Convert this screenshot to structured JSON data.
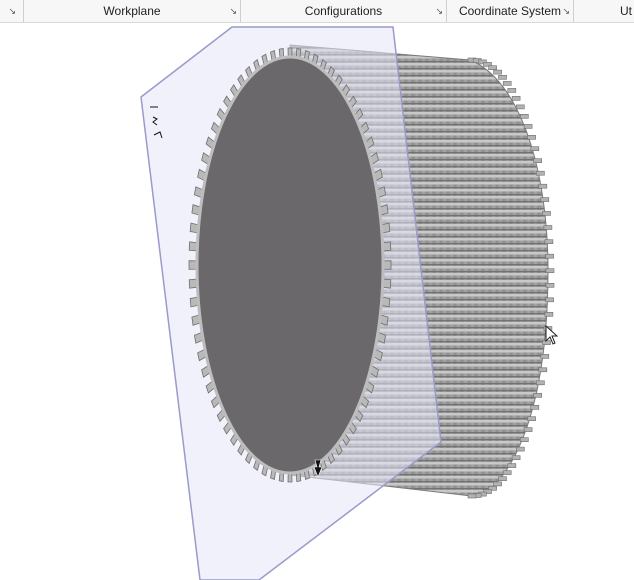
{
  "ribbon": {
    "groups": [
      {
        "label": "",
        "launcher": "↘"
      },
      {
        "label": "Workplane",
        "launcher": "↘"
      },
      {
        "label": "Configurations",
        "launcher": "↘"
      },
      {
        "label": "Coordinate System",
        "launcher": "↘"
      },
      {
        "label": "Ut",
        "launcher": ""
      }
    ]
  },
  "model": {
    "teeth_count": 72,
    "colors": {
      "face": "#6b686c",
      "body": "#9a9a9a",
      "tooth": "#b9b9b9",
      "plane_fill": "#e8e8f8",
      "plane_edge": "#9898c8"
    }
  },
  "icons": [
    "triad-icon",
    "cursor-arrow-icon",
    "drag-handle-icon"
  ]
}
